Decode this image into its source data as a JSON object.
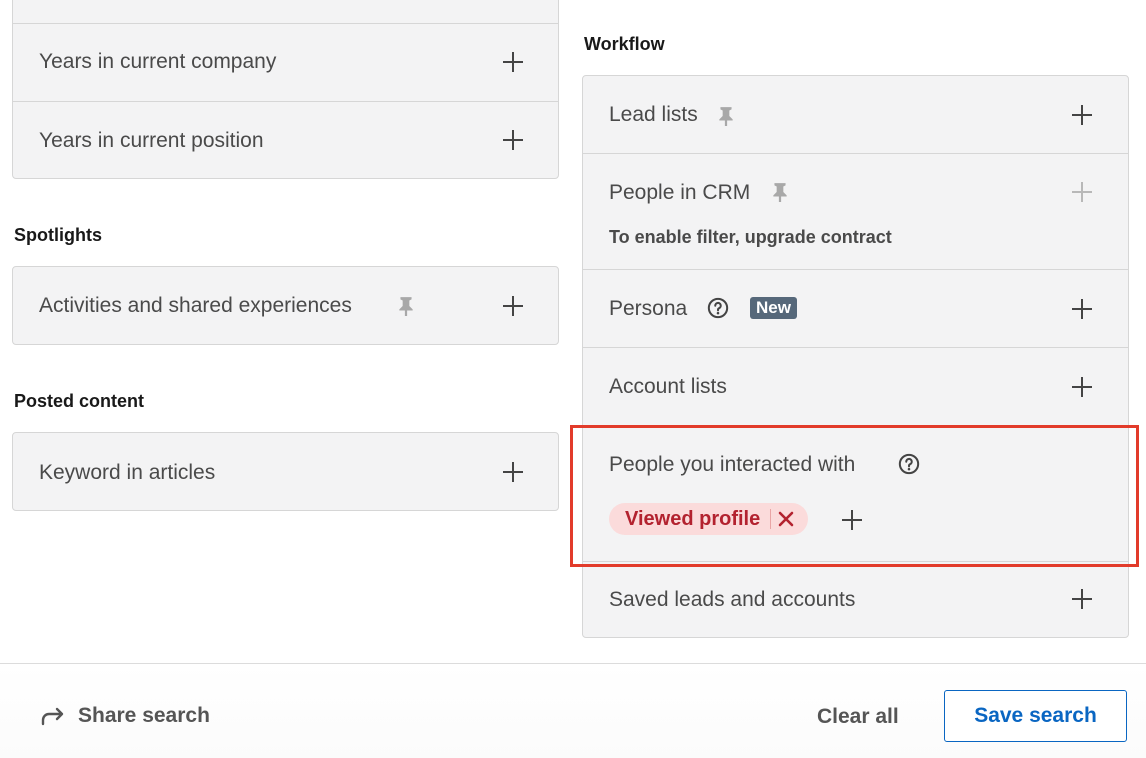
{
  "left": {
    "top_card": {
      "rows": [
        "Years in current company",
        "Years in current position"
      ]
    },
    "spotlights": {
      "title": "Spotlights",
      "rows": [
        "Activities and shared experiences"
      ]
    },
    "posted_content": {
      "title": "Posted content",
      "rows": [
        "Keyword in articles"
      ]
    }
  },
  "workflow": {
    "title": "Workflow",
    "lead_lists": "Lead lists",
    "people_in_crm": "People in CRM",
    "crm_note": "To enable filter, upgrade contract",
    "persona": "Persona",
    "persona_badge": "New",
    "account_lists": "Account lists",
    "people_interacted": "People you interacted with",
    "chip_label": "Viewed profile",
    "saved_leads": "Saved leads and accounts"
  },
  "footer": {
    "share_label": "Share search",
    "clear_label": "Clear all",
    "save_label": "Save search"
  },
  "colors": {
    "accent": "#0a66c2",
    "chip_bg": "#fbdbdb",
    "chip_text": "#b3222f",
    "highlight": "#e23b2a",
    "badge": "#56687a"
  }
}
